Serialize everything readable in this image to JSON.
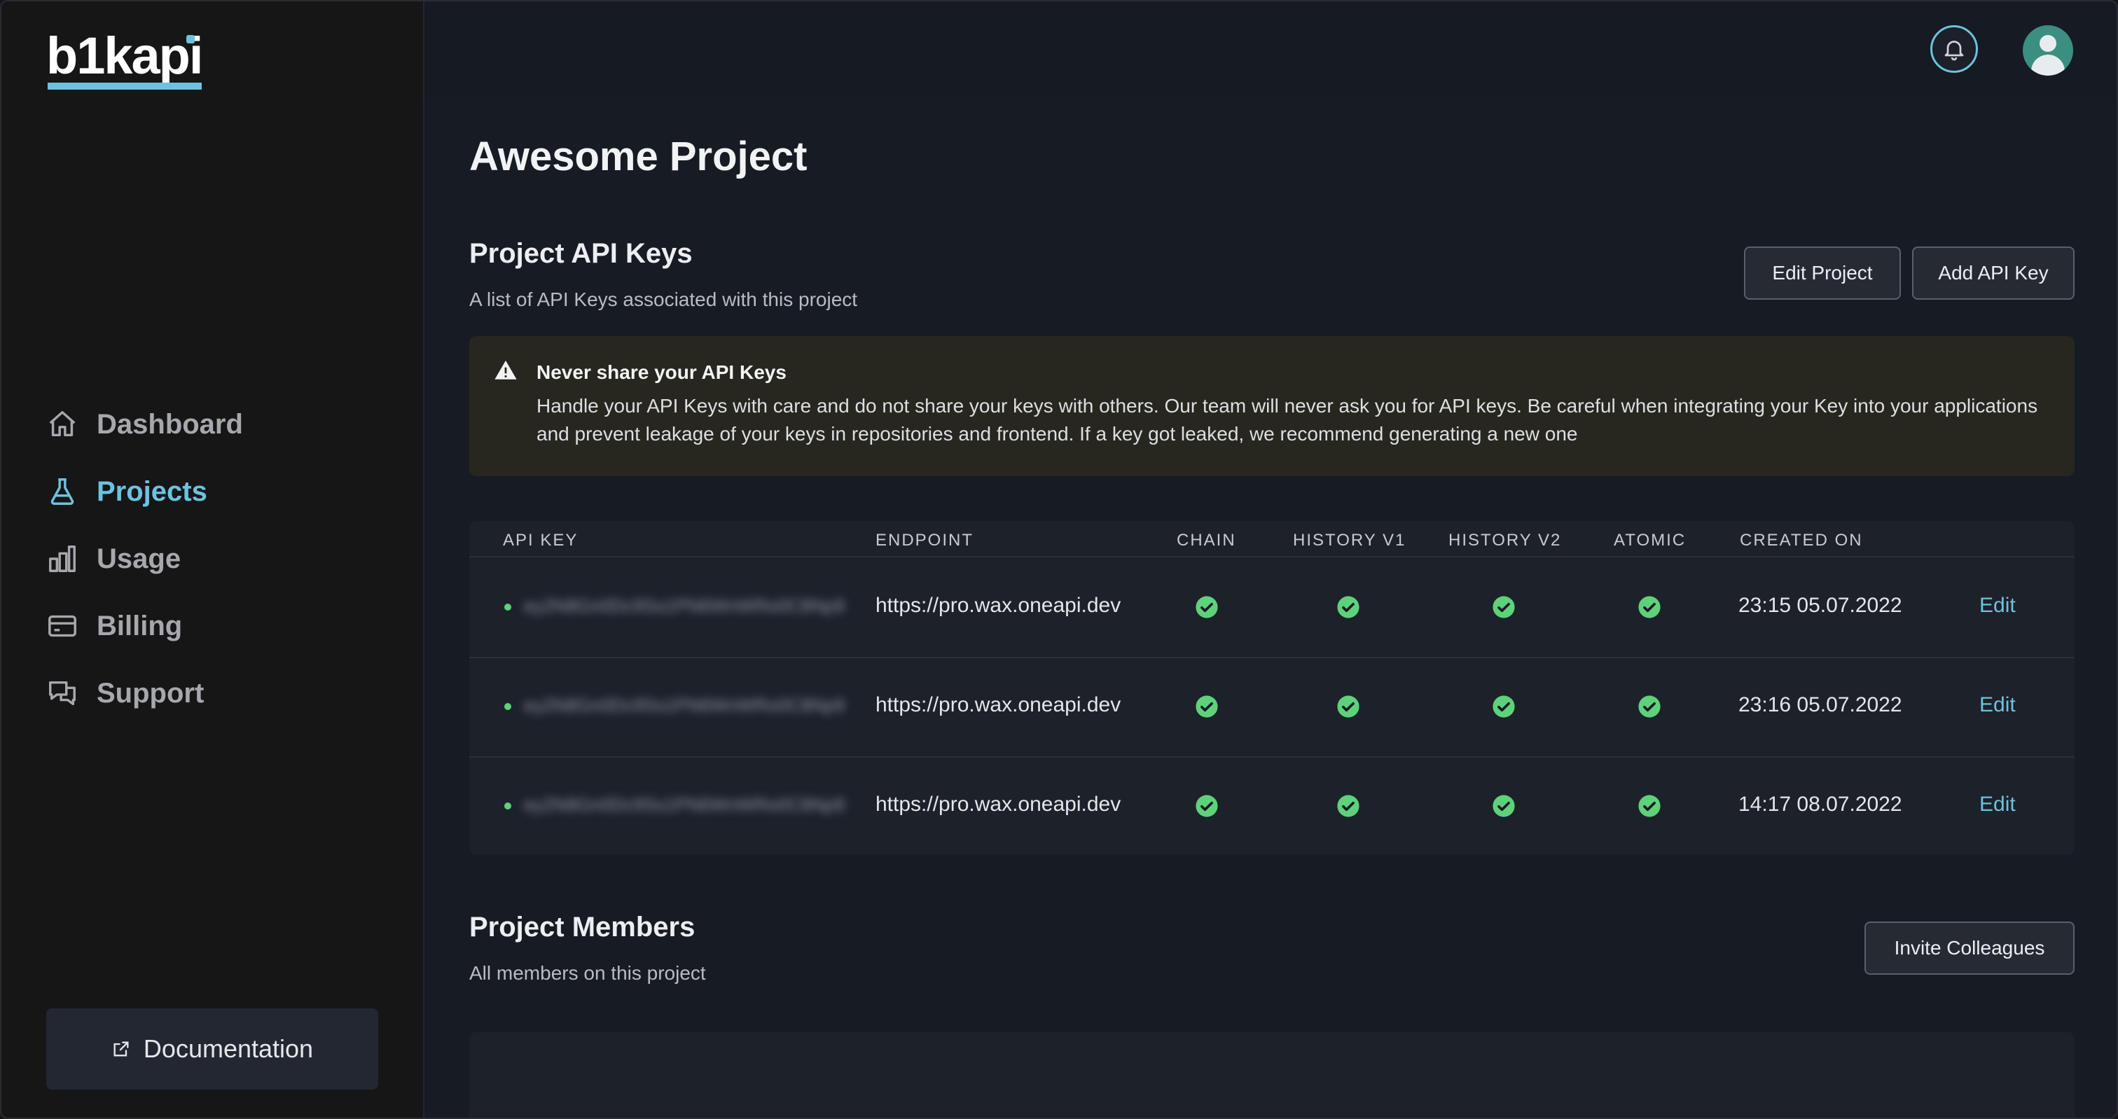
{
  "brand": {
    "logo_text": "b1kapi"
  },
  "sidebar": {
    "items": [
      {
        "label": "Dashboard",
        "icon": "home-icon",
        "active": false
      },
      {
        "label": "Projects",
        "icon": "flask-icon",
        "active": true
      },
      {
        "label": "Usage",
        "icon": "bar-chart-icon",
        "active": false
      },
      {
        "label": "Billing",
        "icon": "credit-card-icon",
        "active": false
      },
      {
        "label": "Support",
        "icon": "chat-icon",
        "active": false
      }
    ],
    "documentation_label": "Documentation"
  },
  "header": {
    "bell_icon": "bell-icon",
    "avatar_icon": "user-avatar-icon"
  },
  "page": {
    "title": "Awesome Project"
  },
  "api_keys_section": {
    "title": "Project API Keys",
    "subtitle": "A list of API Keys associated with this project",
    "edit_project_label": "Edit Project",
    "add_api_key_label": "Add API Key"
  },
  "warning": {
    "title": "Never share your API Keys",
    "text": "Handle your API Keys with care and do not share your keys with others. Our team will never ask you for API keys. Be careful when integrating your Key into your applications and prevent leakage of your keys in repositories and frontend. If a key got leaked, we recommend generating a new one"
  },
  "table": {
    "columns": [
      "API KEY",
      "ENDPOINT",
      "CHAIN",
      "HISTORY V1",
      "HISTORY V2",
      "ATOMIC",
      "CREATED ON"
    ],
    "rows": [
      {
        "api_key": "ey2N8Gn0Dc9Ss1PN6WnWRo0C8Np9",
        "endpoint": "https://pro.wax.oneapi.dev",
        "created_on": "23:15 05.07.2022",
        "edit_label": "Edit"
      },
      {
        "api_key": "ey2N8Gn0Dc9Ss1PN6WnWRo0C8Np9",
        "endpoint": "https://pro.wax.oneapi.dev",
        "created_on": "23:16 05.07.2022",
        "edit_label": "Edit"
      },
      {
        "api_key": "ey2N8Gn0Dc9Ss1PN6WnWRo0C8Np9",
        "endpoint": "https://pro.wax.oneapi.dev",
        "created_on": "14:17 08.07.2022",
        "edit_label": "Edit"
      }
    ]
  },
  "members_section": {
    "title": "Project Members",
    "subtitle": "All members on this project",
    "invite_label": "Invite Colleagues"
  },
  "colors": {
    "accent": "#6cc3de",
    "success": "#5ed27a",
    "background": "#171b24",
    "sidebar": "#161617"
  }
}
